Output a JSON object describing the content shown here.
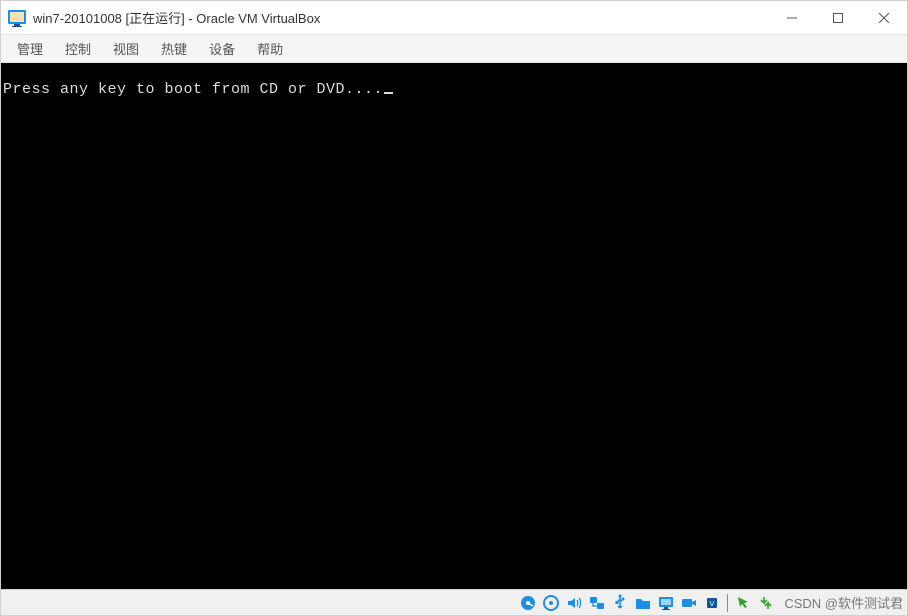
{
  "title": "win7-20101008 [正在运行] - Oracle VM VirtualBox",
  "menu": {
    "manage": "管理",
    "control": "控制",
    "view": "视图",
    "hotkeys": "热键",
    "devices": "设备",
    "help": "帮助"
  },
  "console": {
    "boot_prompt": "Press any key to boot from CD or DVD...."
  },
  "statusbar": {
    "icons": {
      "hdd": "hard-disk",
      "optical": "optical-drive",
      "audio": "audio",
      "network": "network",
      "usb": "usb",
      "shared": "shared-folders",
      "display": "display",
      "recording": "recording",
      "cpu": "cpu-status",
      "mouse": "mouse-integration",
      "keyboard": "keyboard-capture"
    },
    "watermark": "CSDN @软件测试君"
  },
  "colors": {
    "icon_blue": "#1a8fe6",
    "icon_dark": "#1256a0",
    "icon_green": "#2fa52f"
  }
}
